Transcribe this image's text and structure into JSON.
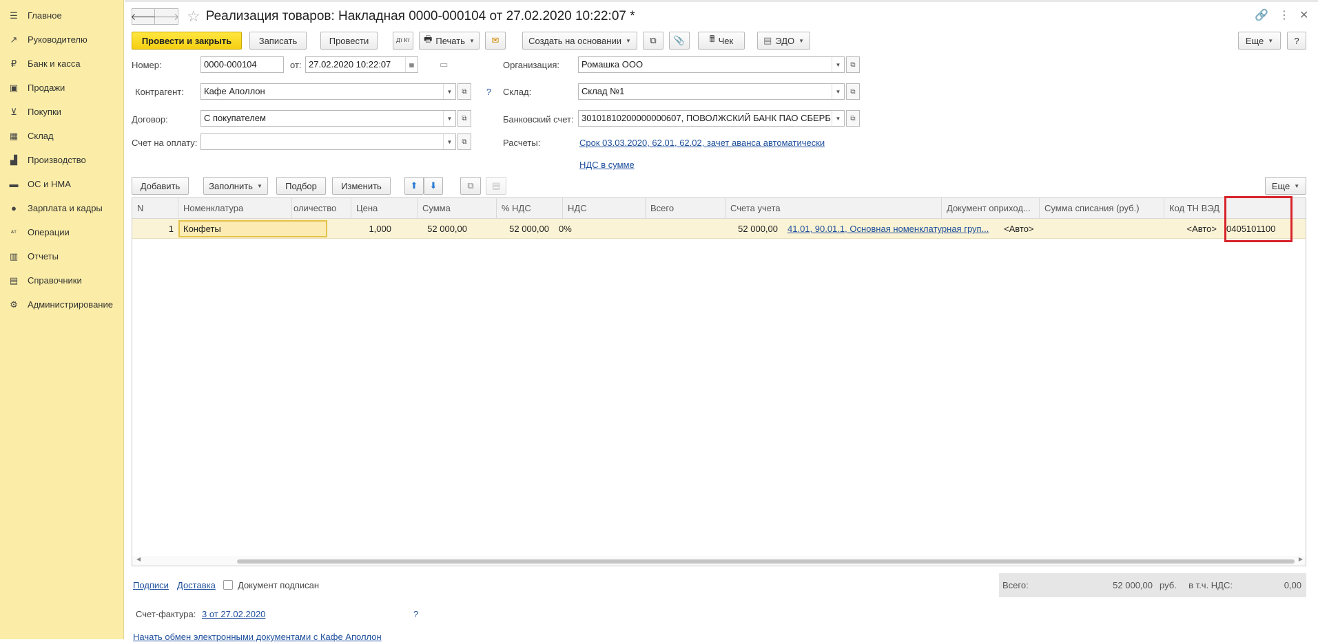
{
  "sidebar": {
    "items": [
      {
        "label": "Главное",
        "icon": "menu-icon"
      },
      {
        "label": "Руководителю",
        "icon": "trend-icon"
      },
      {
        "label": "Банк и касса",
        "icon": "ruble-icon"
      },
      {
        "label": "Продажи",
        "icon": "bag-icon"
      },
      {
        "label": "Покупки",
        "icon": "cart-icon"
      },
      {
        "label": "Склад",
        "icon": "warehouse-icon"
      },
      {
        "label": "Производство",
        "icon": "factory-icon"
      },
      {
        "label": "ОС и НМА",
        "icon": "truck-icon"
      },
      {
        "label": "Зарплата и кадры",
        "icon": "person-icon"
      },
      {
        "label": "Операции",
        "icon": "dt-kt-icon"
      },
      {
        "label": "Отчеты",
        "icon": "chart-icon"
      },
      {
        "label": "Справочники",
        "icon": "book-icon"
      },
      {
        "label": "Администрирование",
        "icon": "gear-icon"
      }
    ]
  },
  "header": {
    "title": "Реализация товаров: Накладная 0000-000104 от 27.02.2020 10:22:07 *"
  },
  "toolbar": {
    "post_close": "Провести и закрыть",
    "save": "Записать",
    "post": "Провести",
    "dtkt": "Дт Кт",
    "print": "Печать",
    "create_based": "Создать на основании",
    "check": "Чек",
    "edo": "ЭДО",
    "more": "Еще",
    "help": "?"
  },
  "form": {
    "number_label": "Номер:",
    "number": "0000-000104",
    "date_label": "от:",
    "date": "27.02.2020 10:22:07",
    "org_label": "Организация:",
    "org": "Ромашка ООО",
    "counterparty_label": "Контрагент:",
    "counterparty": "Кафе Аполлон",
    "warehouse_label": "Склад:",
    "warehouse": "Склад №1",
    "contract_label": "Договор:",
    "contract": "С покупателем",
    "bank_label": "Банковский счет:",
    "bank": "30101810200000000607, ПОВОЛЖСКИЙ БАНК ПАО СБЕРБ",
    "invoice_label": "Счет на оплату:",
    "invoice": "",
    "settlements_label": "Расчеты:",
    "settlements_link": "Срок 03.03.2020, 62.01, 62.02, зачет аванса автоматически",
    "vat_link": "НДС в сумме",
    "help": "?"
  },
  "table_toolbar": {
    "add": "Добавить",
    "fill": "Заполнить",
    "pick": "Подбор",
    "change": "Изменить",
    "more": "Еще"
  },
  "table": {
    "columns": [
      "N",
      "Номенклатура",
      "оличество",
      "Цена",
      "Сумма",
      "% НДС",
      "НДС",
      "Всего",
      "Счета учета",
      "Документ оприход...",
      "Сумма списания (руб.)",
      "Код ТН ВЭД"
    ],
    "rows": [
      [
        "1",
        "Конфеты",
        "1,000",
        "52 000,00",
        "52 000,00",
        "0%",
        "",
        "52 000,00",
        "41.01, 90.01.1, Основная номенклатурная груп...",
        "<Авто>",
        "<Авто>",
        "0405101100"
      ]
    ]
  },
  "footer": {
    "signatures": "Подписи",
    "delivery": "Доставка",
    "signed": "Документ подписан",
    "total_label": "Всего:",
    "total": "52 000,00",
    "currency": "руб.",
    "vat_label": "в т.ч. НДС:",
    "vat": "0,00",
    "invoice_label": "Счет-фактура:",
    "invoice_link": "3 от 27.02.2020",
    "help": "?",
    "edo_link": "Начать обмен электронными документами с Кафе Аполлон"
  }
}
